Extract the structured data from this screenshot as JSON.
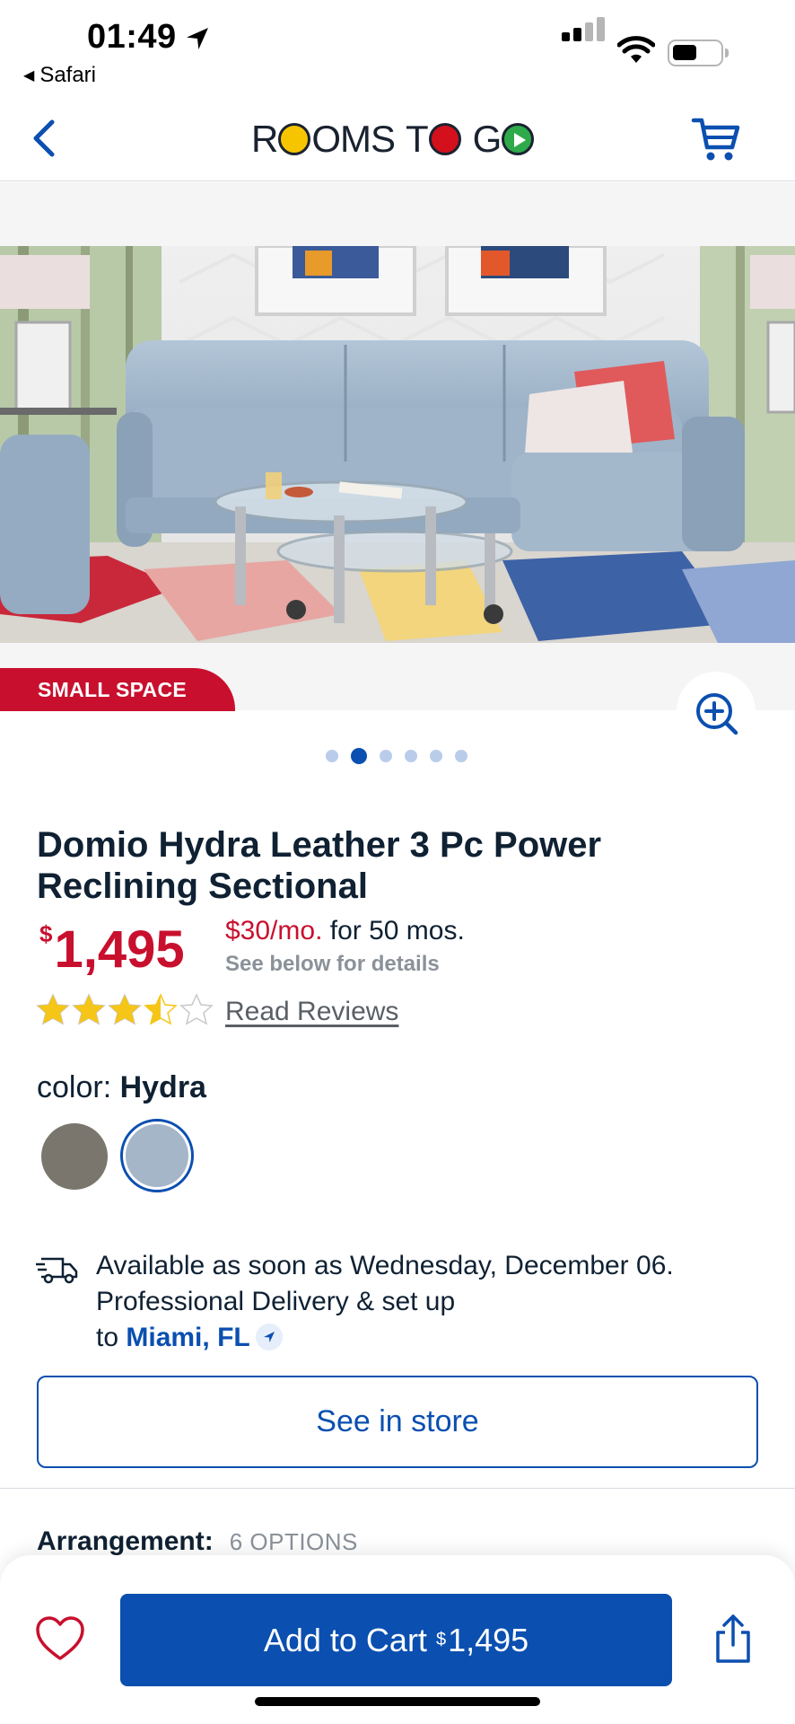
{
  "status_bar": {
    "time": "01:49",
    "back_app": "Safari"
  },
  "header": {
    "logo_text": "ROOMS TO GO"
  },
  "hero": {
    "badge": "SMALL SPACE",
    "carousel": {
      "total": 6,
      "active_index": 1
    }
  },
  "product": {
    "title": "Domio Hydra Leather 3 Pc Power Reclining Sectional",
    "price_symbol": "$",
    "price": "1,495",
    "financing_amount": "$30/mo.",
    "financing_term": "for 50 mos.",
    "financing_details": "See below for details",
    "rating": 3.5,
    "rating_max": 5,
    "reviews_link": "Read Reviews",
    "color_label": "color:",
    "color_value": "Hydra",
    "swatches": [
      {
        "name": "Gray",
        "color": "#7a766d",
        "selected": false
      },
      {
        "name": "Hydra",
        "color": "#a6b6c9",
        "selected": true
      }
    ]
  },
  "delivery": {
    "line1": "Available as soon as Wednesday, December 06.",
    "line2": "Professional Delivery & set up",
    "to": "to",
    "city": "Miami, FL"
  },
  "store_button": "See in store",
  "arrangement": {
    "label": "Arrangement:",
    "options": "6 OPTIONS"
  },
  "bottom_bar": {
    "add_to_cart": "Add to Cart",
    "price_symbol": "$",
    "price": "1,495"
  },
  "colors": {
    "brand_blue": "#0b4fb0",
    "brand_red": "#c8102e",
    "star_yellow": "#f5c518"
  }
}
